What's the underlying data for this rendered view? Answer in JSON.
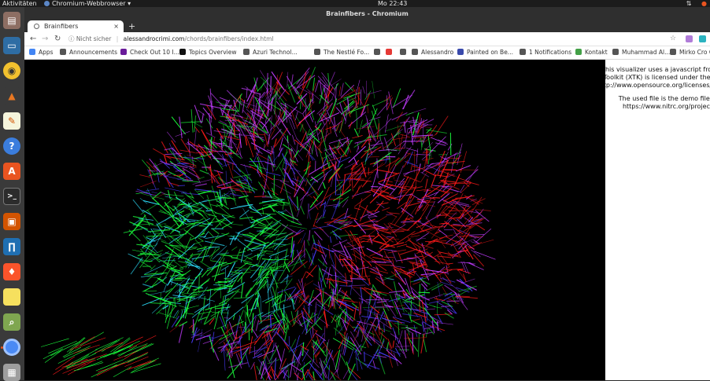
{
  "topbar": {
    "activities": "Aktivitäten",
    "app_menu": "Chromium-Webbrowser ▾",
    "clock": "Mo 22:43"
  },
  "window": {
    "title": "Brainfibers - Chromium"
  },
  "tab": {
    "title": "Brainfibers",
    "close": "×",
    "new": "+"
  },
  "address": {
    "security": "Nicht sicher",
    "host": "alessandrocrimi.com",
    "path": "/chords/brainfibers/index.html"
  },
  "bookmarks": [
    {
      "label": "Apps",
      "color": "#4285f4"
    },
    {
      "label": "Announcements",
      "color": "#555555"
    },
    {
      "label": "Check Out 10 I...",
      "color": "#6a1b9a"
    },
    {
      "label": "Topics Overview",
      "color": "#111111"
    },
    {
      "label": "Azuri Technol...",
      "color": "#555555"
    },
    {
      "label": "The Nestlé Fo...",
      "color": "#555555"
    },
    {
      "label": "",
      "color": "#555555"
    },
    {
      "label": "",
      "color": "#e53935"
    },
    {
      "label": "",
      "color": "#555555"
    },
    {
      "label": "Alessandro",
      "color": "#555555"
    },
    {
      "label": "Painted on Be...",
      "color": "#3949ab"
    },
    {
      "label": "1 Notifications",
      "color": "#555555"
    },
    {
      "label": "Kontakt",
      "color": "#43a047"
    },
    {
      "label": "Muhammad Al...",
      "color": "#555555"
    },
    {
      "label": "Mirko Cro C",
      "color": "#555555"
    }
  ],
  "sidebar_text": [
    "This visualizer uses a javascript from",
    "Toolkit (XTK) is licensed under the M",
    "http://www.opensource.org/licenses/m",
    "",
    "The used file is the demo file of",
    "https://www.nitrc.org/projects/"
  ],
  "dock_icons": [
    "files-icon",
    "document-viewer-icon",
    "rhythmbox-icon",
    "matlab-icon",
    "text-editor-icon",
    "help-icon",
    "software-center-icon",
    "terminal-icon",
    "impress-icon",
    "fiji-icon",
    "brave-icon",
    "notes-icon",
    "image-viewer-icon",
    "chromium-icon",
    "printer-icon"
  ],
  "colors": {
    "fiber_red": "#ff1a1a",
    "fiber_green": "#1aff3c",
    "fiber_blue": "#4a3cff",
    "fiber_magenta": "#c23cff",
    "accent_orange": "#e95420"
  }
}
